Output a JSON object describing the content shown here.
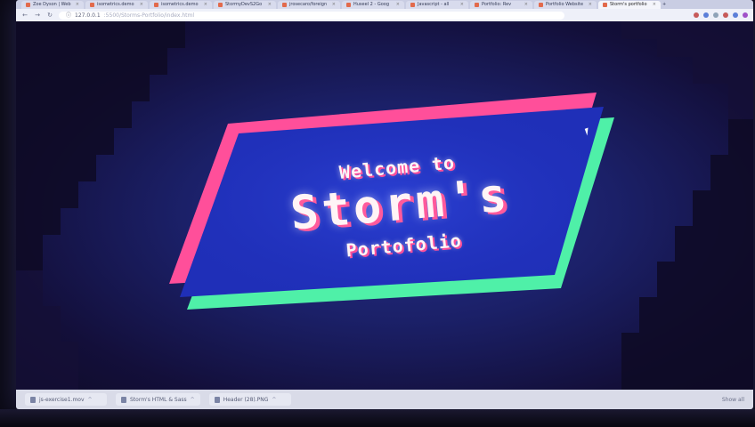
{
  "browser": {
    "tabs": [
      {
        "label": "Zoe Dyson | Web"
      },
      {
        "label": "isometrics.demo"
      },
      {
        "label": "isometrics.demo"
      },
      {
        "label": "StormyDevS2Go"
      },
      {
        "label": "jrosecaro/foreign"
      },
      {
        "label": "Huseel 2 - Goog"
      },
      {
        "label": "Javascript - all"
      },
      {
        "label": "Portfolio: Rev"
      },
      {
        "label": "Portfolio Website"
      },
      {
        "label": "Storm's portfolio"
      }
    ],
    "new_tab_symbol": "+",
    "address": {
      "url_host": "127.0.0.1",
      "url_path": ":5500/Storms-Portfolio/index.html"
    },
    "nav": {
      "back": "←",
      "forward": "→",
      "reload": "↻"
    }
  },
  "page": {
    "welcome": "Welcome to",
    "name": "Storm's",
    "subtitle": "Portofolio"
  },
  "colors": {
    "banner_fill": "#1f2fb8",
    "banner_pink": "#ff4f9a",
    "banner_green": "#4ff0a8",
    "background": "#1b2068"
  },
  "downloads": {
    "items": [
      {
        "label": "js-exercise1.mov"
      },
      {
        "label": "Storm's HTML & Sass"
      },
      {
        "label": "Header (28).PNG"
      }
    ],
    "show_all": "Show all"
  }
}
